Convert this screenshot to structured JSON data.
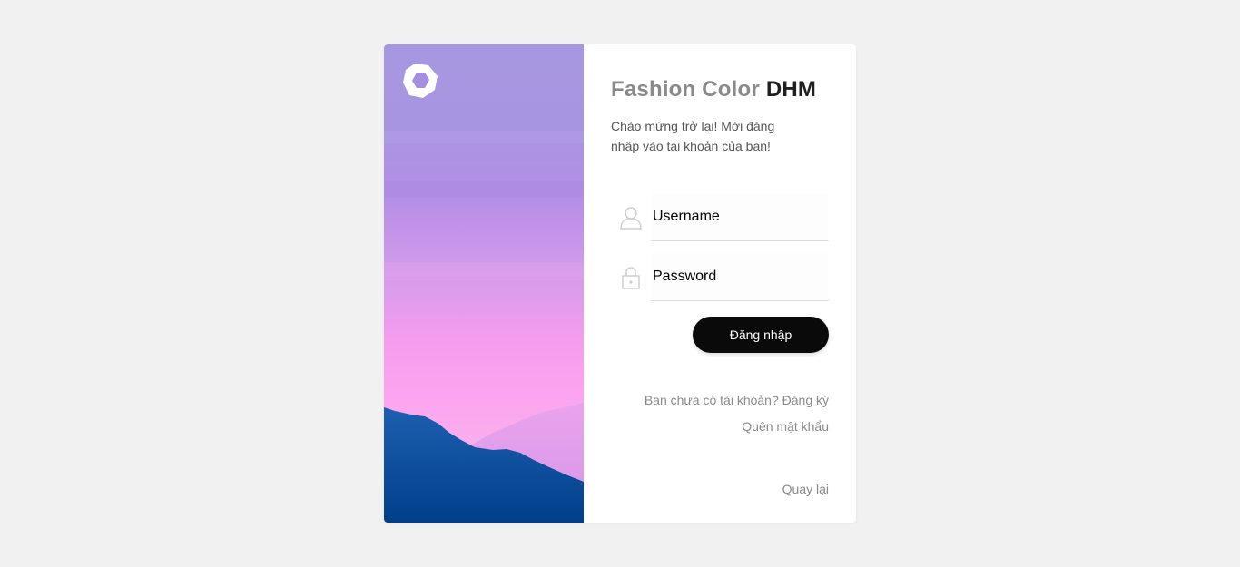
{
  "brand": {
    "title_part1": "Fashion Color",
    "title_part2": "DHM",
    "logo_icon": "hexagon-ring-icon"
  },
  "welcome_text": "Chào mừng trở lại! Mời đăng nhập vào tài khoản của bạn!",
  "form": {
    "username_placeholder": "Username",
    "password_placeholder": "Password",
    "login_label": "Đăng nhập"
  },
  "links": {
    "register": "Bạn chưa có tài khoản? Đăng ký",
    "forgot_password": "Quên mật khẩu",
    "back": "Quay lại"
  },
  "colors": {
    "page_background": "#f1f1f1",
    "button_background": "#0a0a0a",
    "muted_text": "#8a8a8a",
    "accent_pink": "#f9a0ea",
    "accent_purple": "#a58de0",
    "mountain_blue": "#0d4a9a"
  }
}
